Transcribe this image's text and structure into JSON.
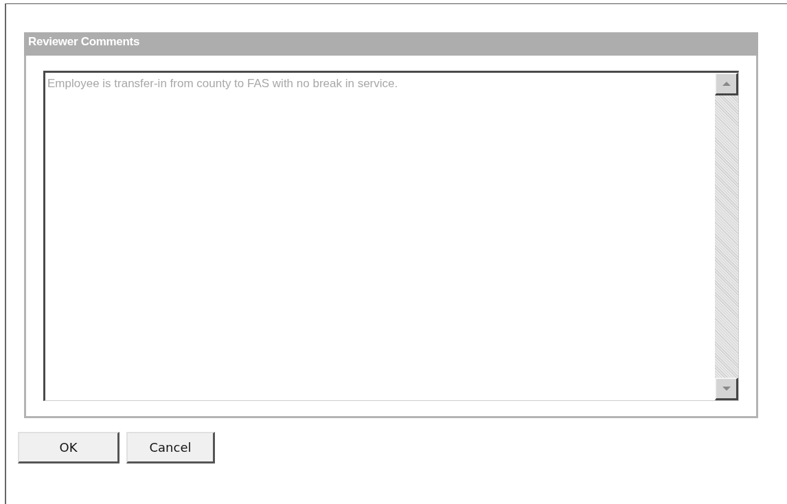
{
  "panel": {
    "title": "Reviewer Comments"
  },
  "comments": {
    "value": "Employee is transfer-in from county to FAS with no break in service.",
    "disabled": true
  },
  "buttons": [
    {
      "label": "OK"
    },
    {
      "label": "Cancel"
    }
  ]
}
